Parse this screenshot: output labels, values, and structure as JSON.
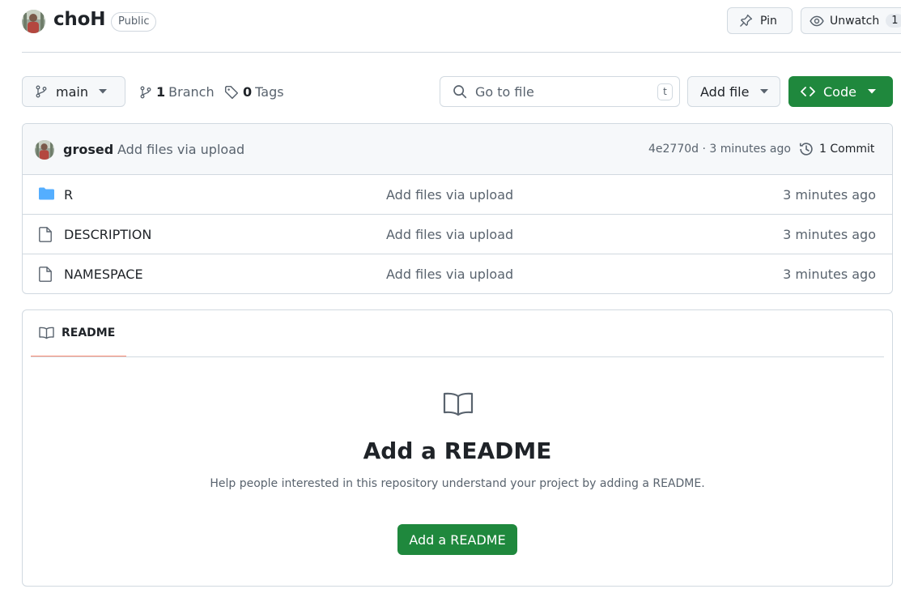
{
  "repo": {
    "name": "choH",
    "visibility": "Public",
    "avatar_icon": "user-avatar"
  },
  "header_actions": {
    "pin_label": "Pin",
    "unwatch_label": "Unwatch",
    "watch_count": "1"
  },
  "toolbar": {
    "branch_name": "main",
    "branch_count": "1",
    "branch_label": "Branch",
    "tag_count": "0",
    "tag_label": "Tags",
    "search_placeholder": "Go to file",
    "search_shortcut": "t",
    "add_file_label": "Add file",
    "code_label": "Code"
  },
  "latest_commit": {
    "author": "grosed",
    "message": "Add files via upload",
    "meta": "4e2770d · 3 minutes ago",
    "commit_count_label": "1 Commit"
  },
  "files": [
    {
      "name": "R",
      "type": "folder",
      "message": "Add files via upload",
      "time": "3 minutes ago"
    },
    {
      "name": "DESCRIPTION",
      "type": "file",
      "message": "Add files via upload",
      "time": "3 minutes ago"
    },
    {
      "name": "NAMESPACE",
      "type": "file",
      "message": "Add files via upload",
      "time": "3 minutes ago"
    }
  ],
  "readme": {
    "tab_label": "README",
    "title": "Add a README",
    "description": "Help people interested in this repository understand your project by adding a README.",
    "button_label": "Add a README"
  },
  "colors": {
    "primary_green": "#1f883d",
    "folder_blue": "#54aeff",
    "tab_underline": "#fd8c73",
    "border": "#d1d9e0",
    "muted_text": "#59636e"
  }
}
